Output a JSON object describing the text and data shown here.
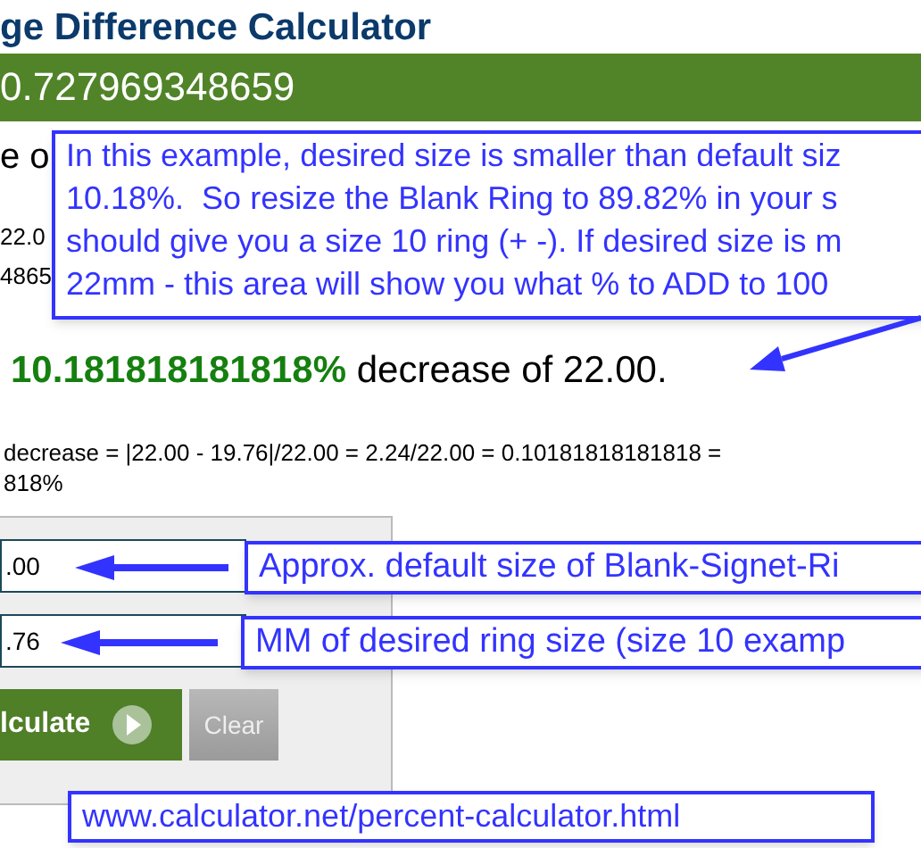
{
  "header": {
    "title": "ge Difference Calculator",
    "result_bar": "0.727969348659"
  },
  "partial_texts": [
    "e o",
    "22.0",
    "4865"
  ],
  "result": {
    "percent": "10.181818181818%",
    "text": "decrease of 22.00."
  },
  "formula": [
    "decrease = |22.00 - 19.76|/22.00 = 2.24/22.00 = 0.10181818181818 =",
    "818%"
  ],
  "form": {
    "fields": [
      {
        "value": ".00"
      },
      {
        "value": ".76"
      }
    ],
    "buttons": [
      {
        "label": "lculate",
        "kind": "primary"
      },
      {
        "label": "Clear",
        "kind": "secondary"
      }
    ]
  },
  "annotations": [
    {
      "lines": [
        "In this example, desired size is smaller than default siz",
        "10.18%.  So resize the Blank Ring to 89.82% in your s",
        "should give you a size 10 ring (+ -). If desired size is m",
        "22mm - this area will show you what % to ADD to 100"
      ]
    },
    {
      "lines": [
        "Approx. default size of Blank-Signet-Ri"
      ]
    },
    {
      "lines": [
        "MM of desired ring size (size 10 examp"
      ]
    },
    {
      "lines": [
        "www.calculator.net/percent-calculator.html"
      ]
    }
  ]
}
